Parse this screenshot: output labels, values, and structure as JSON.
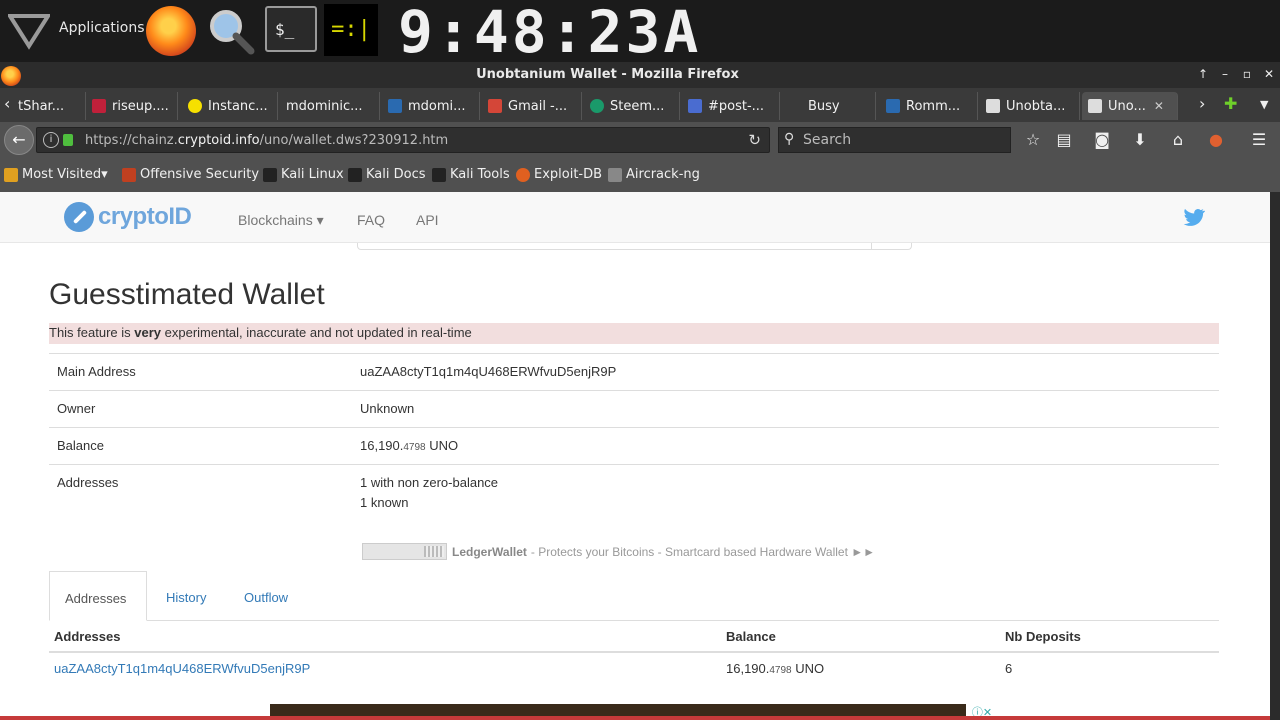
{
  "desktop": {
    "apps_label": "Applications",
    "clock": "9:48:23A",
    "terminal_glyph": "$_",
    "cpu_glyph": "=:|"
  },
  "window": {
    "title": "Unobtanium Wallet - Mozilla Firefox"
  },
  "tabs": [
    {
      "label": "tShar...",
      "color": "#3a3a3a"
    },
    {
      "label": "riseup....",
      "color": "#c0203a"
    },
    {
      "label": "Instanc...",
      "color": "#f6e000"
    },
    {
      "label": "mdominic...",
      "color": "#3a3a3a"
    },
    {
      "label": "mdomi...",
      "color": "#2a6ab0"
    },
    {
      "label": "Gmail -...",
      "color": "#d44638"
    },
    {
      "label": "Steem...",
      "color": "#1a9a6a"
    },
    {
      "label": "#post-...",
      "color": "#4a6cd0"
    },
    {
      "label": "Busy",
      "color": "#3a3a3a"
    },
    {
      "label": "Romm...",
      "color": "#2a6ab0"
    },
    {
      "label": "Unobta...",
      "color": "#dddddd"
    },
    {
      "label": "Uno...",
      "color": "#dddddd"
    }
  ],
  "navbar": {
    "url_prefix": "https://chainz.",
    "url_domain": "cryptoid.info",
    "url_path": "/uno/wallet.dws?230912.htm",
    "search_placeholder": "Search"
  },
  "bookmarks": [
    {
      "label": "Most Visited▾",
      "color": "#e0a020"
    },
    {
      "label": "Offensive Security",
      "color": "#c04020"
    },
    {
      "label": "Kali Linux",
      "color": "#222222"
    },
    {
      "label": "Kali Docs",
      "color": "#222222"
    },
    {
      "label": "Kali Tools",
      "color": "#222222"
    },
    {
      "label": "Exploit-DB",
      "color": "#e06020"
    },
    {
      "label": "Aircrack-ng",
      "color": "#888888"
    }
  ],
  "site": {
    "logo": "cryptoID",
    "nav": {
      "blockchains": "Blockchains ▾",
      "faq": "FAQ",
      "api": "API"
    }
  },
  "wallet": {
    "heading": "Guesstimated Wallet",
    "warning_before": "This feature is ",
    "warning_bold": "very",
    "warning_after": " experimental, inaccurate and not updated in real-time",
    "rows": {
      "main_address_label": "Main Address",
      "main_address": "uaZAA8ctyT1q1m4qU468ERWfvuD5enjR9P",
      "owner_label": "Owner",
      "owner": "Unknown",
      "balance_label": "Balance",
      "balance_int": "16,190.",
      "balance_dec": "4798",
      "balance_unit": " UNO",
      "addresses_label": "Addresses",
      "addresses_line1": "1 with non zero-balance",
      "addresses_line2": "1 known"
    },
    "ad": {
      "brand": "LedgerWallet",
      "text": "- Protects your Bitcoins - Smartcard based Hardware Wallet ►►"
    },
    "tabs": {
      "addresses": "Addresses",
      "history": "History",
      "outflow": "Outflow"
    },
    "table": {
      "headers": [
        "Addresses",
        "Balance",
        "Nb Deposits"
      ],
      "row": {
        "address": "uaZAA8ctyT1q1m4qU468ERWfvuD5enjR9P",
        "balance_int": "16,190.",
        "balance_dec": "4798",
        "balance_unit": " UNO",
        "deposits": "6"
      }
    }
  }
}
